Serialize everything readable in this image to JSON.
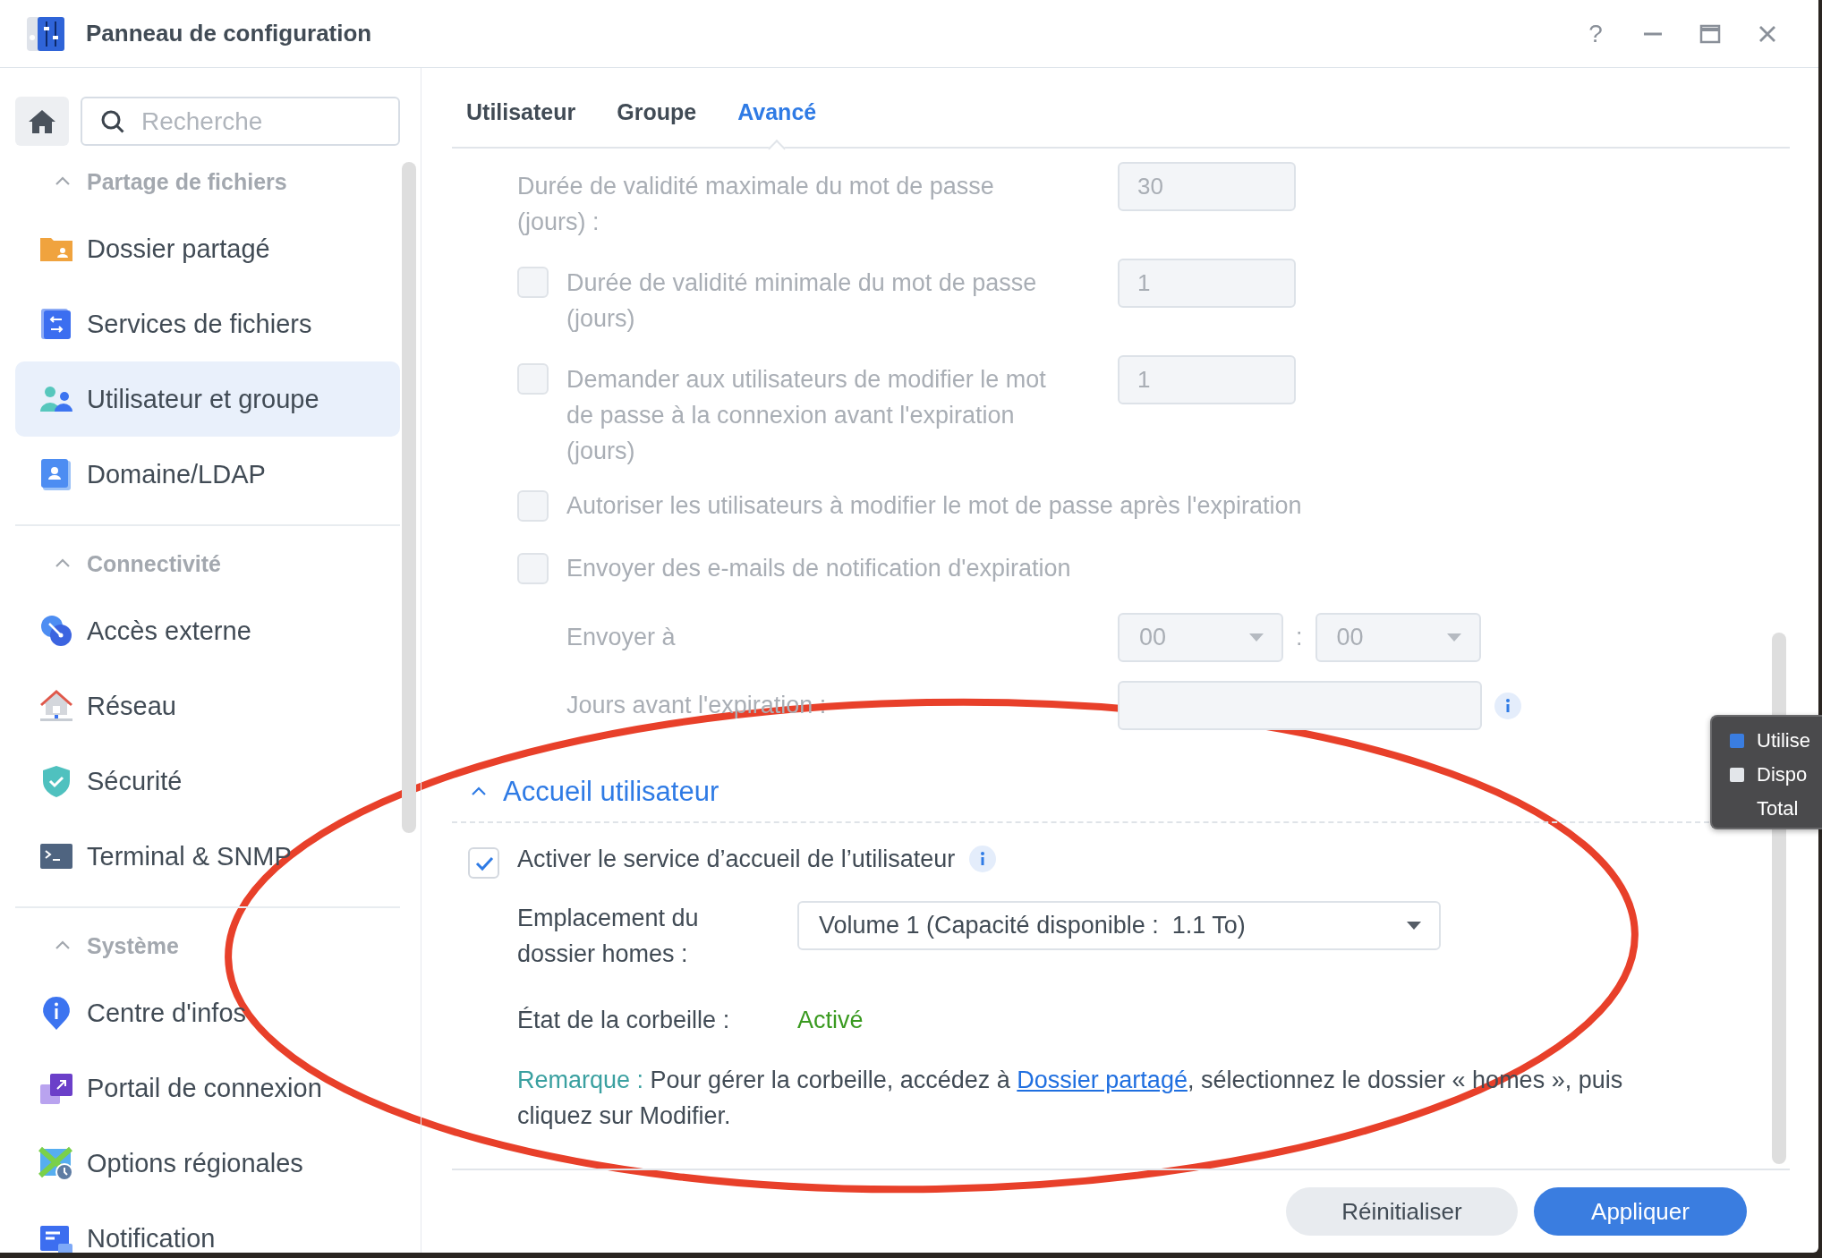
{
  "window": {
    "title": "Panneau de configuration",
    "help": "?"
  },
  "sidebar": {
    "search": {
      "placeholder": "Recherche"
    },
    "sections": [
      {
        "title": "Partage de fichiers",
        "expanded": true,
        "items": [
          {
            "label": "Dossier partagé",
            "kind": "folder",
            "selected": false
          },
          {
            "label": "Services de fichiers",
            "kind": "file-services",
            "selected": false
          },
          {
            "label": "Utilisateur et groupe",
            "kind": "users",
            "selected": true
          },
          {
            "label": "Domaine/LDAP",
            "kind": "domain",
            "selected": false
          }
        ]
      },
      {
        "title": "Connectivité",
        "expanded": true,
        "items": [
          {
            "label": "Accès externe",
            "kind": "external",
            "selected": false
          },
          {
            "label": "Réseau",
            "kind": "network",
            "selected": false
          },
          {
            "label": "Sécurité",
            "kind": "security",
            "selected": false
          },
          {
            "label": "Terminal & SNMP",
            "kind": "terminal",
            "selected": false
          }
        ]
      },
      {
        "title": "Système",
        "expanded": true,
        "items": [
          {
            "label": "Centre d'infos",
            "kind": "info",
            "selected": false
          },
          {
            "label": "Portail de connexion",
            "kind": "portal",
            "selected": false
          },
          {
            "label": "Options régionales",
            "kind": "regional",
            "selected": false
          },
          {
            "label": "Notification",
            "kind": "notification",
            "selected": false
          }
        ]
      }
    ]
  },
  "tabs": [
    {
      "label": "Utilisateur",
      "selected": false
    },
    {
      "label": "Groupe",
      "selected": false
    },
    {
      "label": "Avancé",
      "selected": true
    }
  ],
  "password_rows": [
    {
      "kind": "field",
      "label": "Durée de validité maximale du mot de passe (jours) :",
      "value": "30",
      "disabled": true
    },
    {
      "kind": "check-field",
      "label": "Durée de validité minimale du mot de passe (jours)",
      "value": "1",
      "checked": false,
      "disabled": true
    },
    {
      "kind": "check-field",
      "label": "Demander aux utilisateurs de modifier le mot de passe à la connexion avant l'expiration (jours)",
      "value": "1",
      "checked": false,
      "disabled": true
    },
    {
      "kind": "check",
      "label": "Autoriser les utilisateurs à modifier le mot de passe après l'expiration",
      "checked": false,
      "disabled": true
    },
    {
      "kind": "check",
      "label": "Envoyer des e-mails de notification d'expiration",
      "checked": false,
      "disabled": true
    },
    {
      "kind": "time",
      "label": "Envoyer à",
      "hours": "00",
      "separator": ":",
      "minutes": "00",
      "disabled": true
    },
    {
      "kind": "field-info",
      "label": "Jours avant l'expiration :",
      "disabled": true
    }
  ],
  "home_section": {
    "title": "Accueil utilisateur",
    "expanded": true,
    "enable": {
      "label": "Activer le service d’accueil de l’utilisateur",
      "checked": true
    },
    "location": {
      "label": "Emplacement du dossier homes :",
      "value": "Volume 1 (Capacité disponible :  1.1 To)"
    },
    "recycle": {
      "label": "État de la corbeille :",
      "value": "Activé"
    },
    "note": {
      "label": "Remarque :",
      "before": " Pour gérer la corbeille, accédez à ",
      "link": "Dossier partagé",
      "after": ", sélectionnez le dossier « homes », puis cliquez sur Modifier."
    }
  },
  "buttons": [
    {
      "label": "Réinitialiser",
      "kind": "secondary"
    },
    {
      "label": "Appliquer",
      "kind": "primary"
    }
  ],
  "tooltip": {
    "items": [
      {
        "label": "Utilise",
        "color": "#3a7de0"
      },
      {
        "label": "Dispo",
        "color": "#e3e6ea"
      },
      {
        "label": "Total"
      }
    ]
  }
}
